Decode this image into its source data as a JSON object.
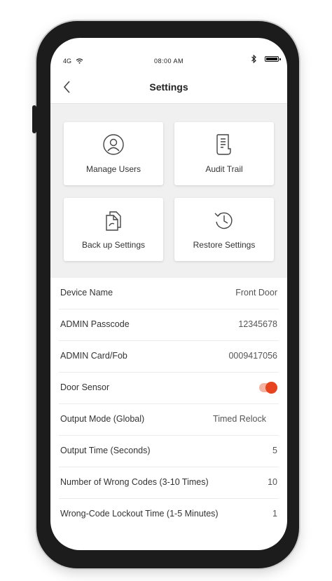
{
  "status_bar": {
    "network": "4G",
    "time": "08:00 AM"
  },
  "header": {
    "title": "Settings"
  },
  "tiles": [
    {
      "label": "Manage Users",
      "icon": "user-icon"
    },
    {
      "label": "Audit Trail",
      "icon": "document-icon"
    },
    {
      "label": "Back up Settings",
      "icon": "backup-icon"
    },
    {
      "label": "Restore Settings",
      "icon": "restore-icon"
    }
  ],
  "settings": [
    {
      "label": "Device Name",
      "value": "Front Door"
    },
    {
      "label": "ADMIN Passcode",
      "value": "12345678"
    },
    {
      "label": "ADMIN Card/Fob",
      "value": "0009417056"
    },
    {
      "label": "Door Sensor",
      "toggle_on": true
    },
    {
      "label": "Output Mode (Global)",
      "value": "Timed Relock"
    },
    {
      "label": "Output Time (Seconds)",
      "value": "5"
    },
    {
      "label": "Number of Wrong Codes (3-10 Times)",
      "value": "10"
    },
    {
      "label": "Wrong-Code Lockout Time (1-5 Minutes)",
      "value": "1"
    }
  ],
  "colors": {
    "accent": "#e8431f",
    "accent_track": "#f3b4a3",
    "panel_bg": "#f0f0f0"
  }
}
